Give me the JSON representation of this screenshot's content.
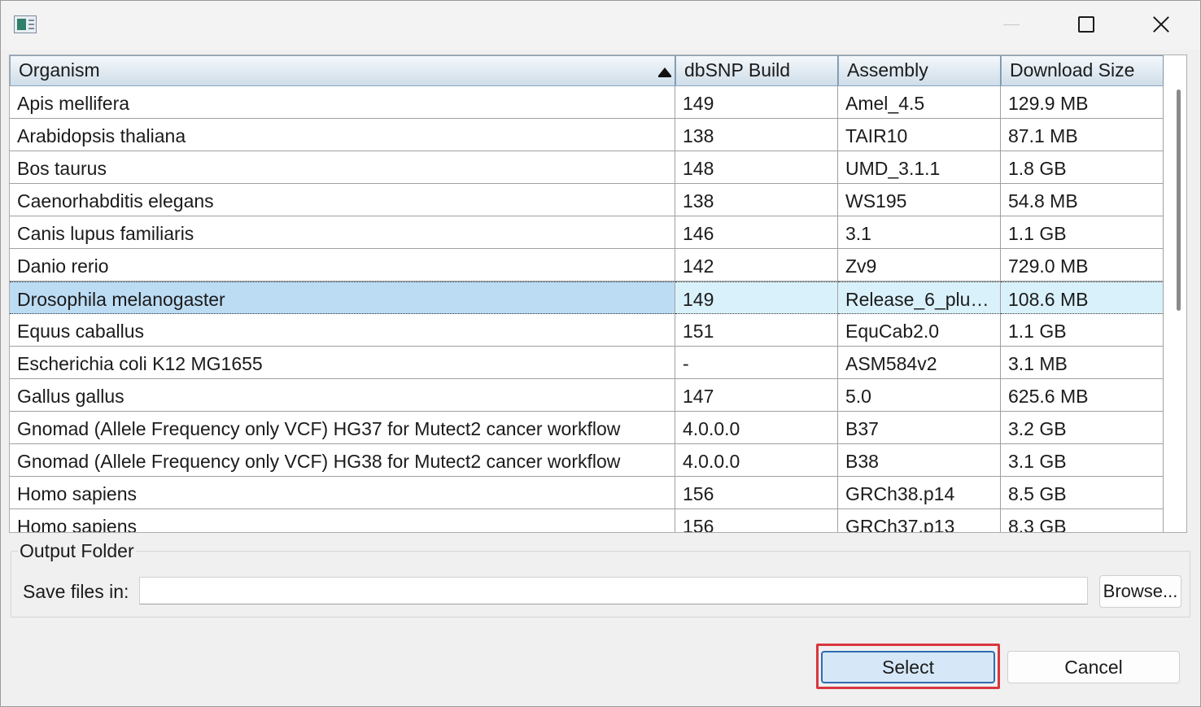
{
  "titlebar": {
    "app_icon": "app-window-icon",
    "minimize_icon": "minimize-icon",
    "maximize_icon": "maximize-icon",
    "close_icon": "close-icon"
  },
  "grid": {
    "columns": [
      "Organism",
      "dbSNP Build",
      "Assembly",
      "Download Size"
    ],
    "sort": {
      "column": "Organism",
      "direction": "ascending",
      "icon": "sort-ascending-icon"
    },
    "rows": [
      [
        "Apis mellifera",
        "149",
        "Amel_4.5",
        "129.9 MB"
      ],
      [
        "Arabidopsis thaliana",
        "138",
        "TAIR10",
        "87.1 MB"
      ],
      [
        "Bos taurus",
        "148",
        "UMD_3.1.1",
        "1.8 GB"
      ],
      [
        "Caenorhabditis elegans",
        "138",
        "WS195",
        "54.8 MB"
      ],
      [
        "Canis lupus familiaris",
        "146",
        "3.1",
        "1.1 GB"
      ],
      [
        "Danio rerio",
        "142",
        "Zv9",
        "729.0 MB"
      ],
      [
        "Drosophila melanogaster",
        "149",
        "Release_6_plus...",
        "108.6 MB"
      ],
      [
        "Equus caballus",
        "151",
        "EquCab2.0",
        "1.1 GB"
      ],
      [
        "Escherichia coli K12 MG1655",
        "-",
        "ASM584v2",
        "3.1 MB"
      ],
      [
        "Gallus gallus",
        "147",
        "5.0",
        "625.6 MB"
      ],
      [
        "Gnomad (Allele Frequency only VCF) HG37 for Mutect2 cancer workflow",
        "4.0.0.0",
        "B37",
        "3.2 GB"
      ],
      [
        "Gnomad (Allele Frequency only VCF) HG38 for Mutect2 cancer workflow",
        "4.0.0.0",
        "B38",
        "3.1 GB"
      ],
      [
        "Homo sapiens",
        "156",
        "GRCh38.p14",
        "8.5 GB"
      ],
      [
        "Homo sapiens",
        "156",
        "GRCh37.p13",
        "8.3 GB"
      ]
    ],
    "selected_row": 6
  },
  "output": {
    "group_label": "Output Folder",
    "save_label": "Save files in:",
    "save_value": "",
    "browse_label": "Browse..."
  },
  "actions": {
    "select_label": "Select",
    "cancel_label": "Cancel"
  },
  "colors": {
    "highlight": "#d9363e",
    "selected_row": "#d9f1fb",
    "select_button": "#d6e8f8"
  }
}
